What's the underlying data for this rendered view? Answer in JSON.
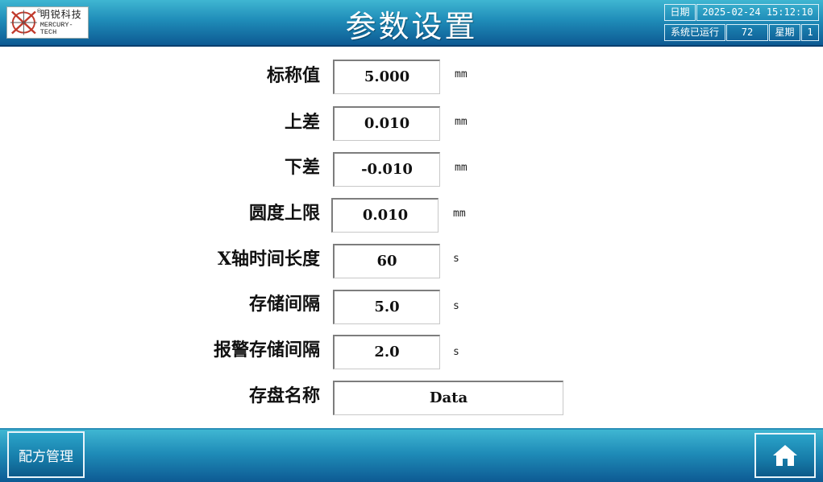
{
  "header": {
    "title": "参数设置",
    "logo": {
      "cn_name": "明锐科技",
      "en_name": "MERCURY-TECH",
      "reg_mark": "®"
    },
    "date_label": "日期",
    "datetime": "2025-02-24 15:12:10",
    "runtime_label": "系统已运行",
    "runtime_value": "72",
    "weekday_label": "星期",
    "weekday_value": "1"
  },
  "form": {
    "fields": [
      {
        "label": "标称值",
        "value": "5.000",
        "unit": "mm"
      },
      {
        "label": "上差",
        "value": "0.010",
        "unit": "mm"
      },
      {
        "label": "下差",
        "value": "-0.010",
        "unit": "mm"
      },
      {
        "label": "圆度上限",
        "value": "0.010",
        "unit": "mm"
      },
      {
        "label": "X轴时间长度",
        "value": "60",
        "unit": "s"
      },
      {
        "label": "存储间隔",
        "value": "5.0",
        "unit": "s"
      },
      {
        "label": "报警存储间隔",
        "value": "2.0",
        "unit": "s"
      },
      {
        "label": "存盘名称",
        "value": "Data"
      }
    ]
  },
  "footer": {
    "recipe_button": "配方管理",
    "home_icon": "home-icon"
  },
  "colors": {
    "header_top": "#3fb6d2",
    "header_bottom": "#0d5a93",
    "field_border": "#7d7d7d",
    "text": "#111111"
  }
}
